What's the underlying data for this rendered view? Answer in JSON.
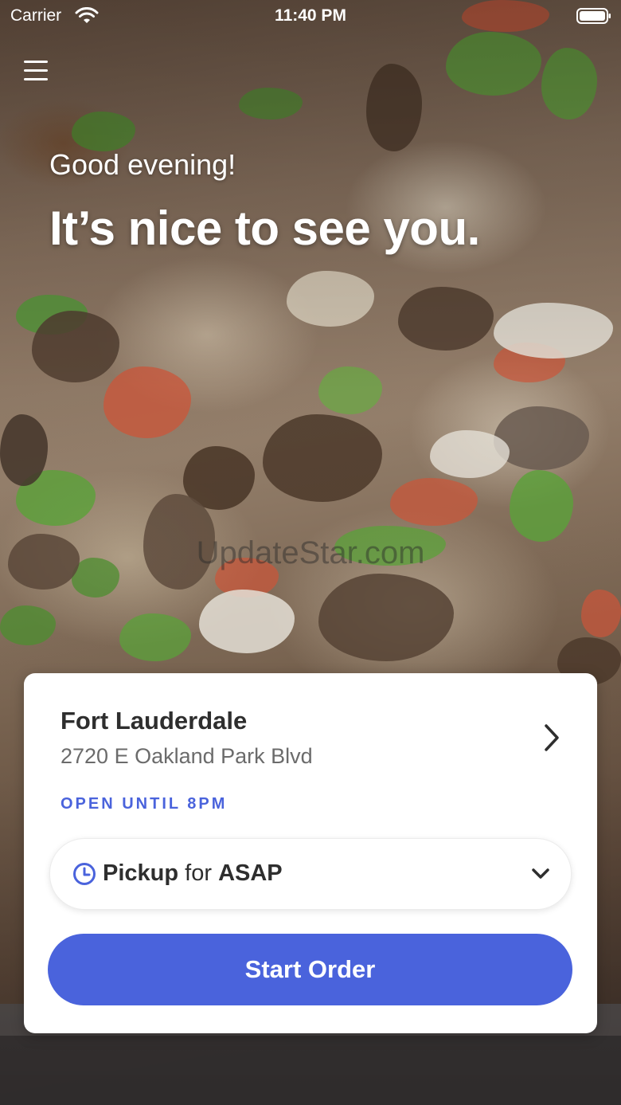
{
  "status_bar": {
    "carrier": "Carrier",
    "time": "11:40 PM"
  },
  "greeting": {
    "salutation": "Good evening!",
    "headline": "It’s nice to see you."
  },
  "watermark": "UpdateStar.com",
  "location": {
    "name": "Fort Lauderdale",
    "address": "2720 E Oakland Park Blvd",
    "hours_status": "OPEN UNTIL 8PM"
  },
  "order_type": {
    "mode": "Pickup",
    "connector": "for",
    "time": "ASAP"
  },
  "actions": {
    "start_order_label": "Start Order"
  },
  "colors": {
    "accent": "#4a63dc",
    "text_primary": "#2e2e2e",
    "text_secondary": "#6b6b6b",
    "card_background": "#ffffff"
  },
  "icons": {
    "menu": "hamburger-menu-icon",
    "wifi": "wifi-icon",
    "battery": "battery-icon",
    "location_chevron": "chevron-right-icon",
    "clock": "clock-icon",
    "dropdown": "chevron-down-icon"
  }
}
